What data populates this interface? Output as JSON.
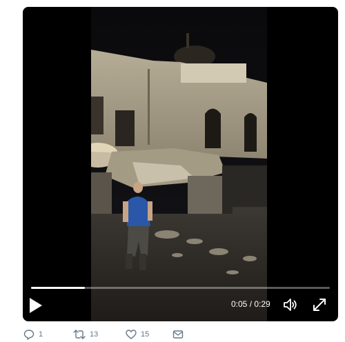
{
  "video": {
    "current_time": "0:05",
    "separator": " / ",
    "duration": "0:29",
    "progress_fraction": 0.18
  },
  "icons": {
    "play": "play-icon",
    "volume": "volume-icon",
    "fullscreen": "fullscreen-icon",
    "reply": "reply-icon",
    "retweet": "retweet-icon",
    "like": "like-icon",
    "message": "direct-message-icon"
  },
  "actions": {
    "reply_count": "1",
    "retweet_count": "13",
    "like_count": "15"
  },
  "colors": {
    "player_bg": "#000000",
    "action_gray": "#657786",
    "progress_fill": "#ffffff"
  }
}
